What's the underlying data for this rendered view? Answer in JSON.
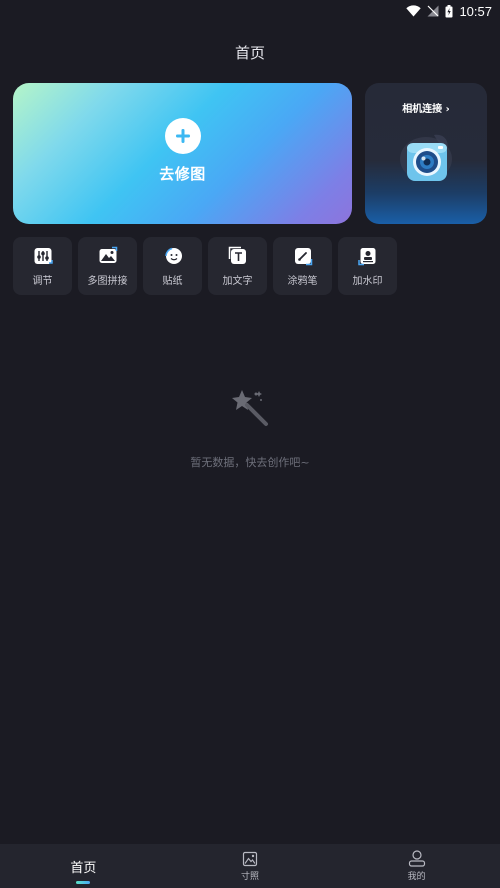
{
  "status_bar": {
    "time": "10:57"
  },
  "header": {
    "title": "首页"
  },
  "edit_card": {
    "label": "去修图"
  },
  "camera_card": {
    "title": "相机连接",
    "chevron": "›"
  },
  "tools": [
    {
      "label": "调节",
      "icon": "adjust-sliders-icon"
    },
    {
      "label": "多图拼接",
      "icon": "image-collage-icon"
    },
    {
      "label": "贴纸",
      "icon": "sticker-icon"
    },
    {
      "label": "加文字",
      "icon": "text-icon"
    },
    {
      "label": "涂鸦笔",
      "icon": "brush-icon"
    },
    {
      "label": "加水印",
      "icon": "watermark-icon"
    }
  ],
  "empty_state": {
    "text": "暂无数据，快去创作吧~"
  },
  "bottom_nav": [
    {
      "label": "首页",
      "active": true
    },
    {
      "label": "寸照",
      "icon": "id-photo-icon"
    },
    {
      "label": "我的",
      "icon": "profile-icon"
    }
  ],
  "colors": {
    "background": "#1b1b23",
    "card": "#262730",
    "accent_gradient_start": "#b5f5c8",
    "accent_gradient_end": "#8d74dc",
    "indicator": "#4aa8f5"
  }
}
